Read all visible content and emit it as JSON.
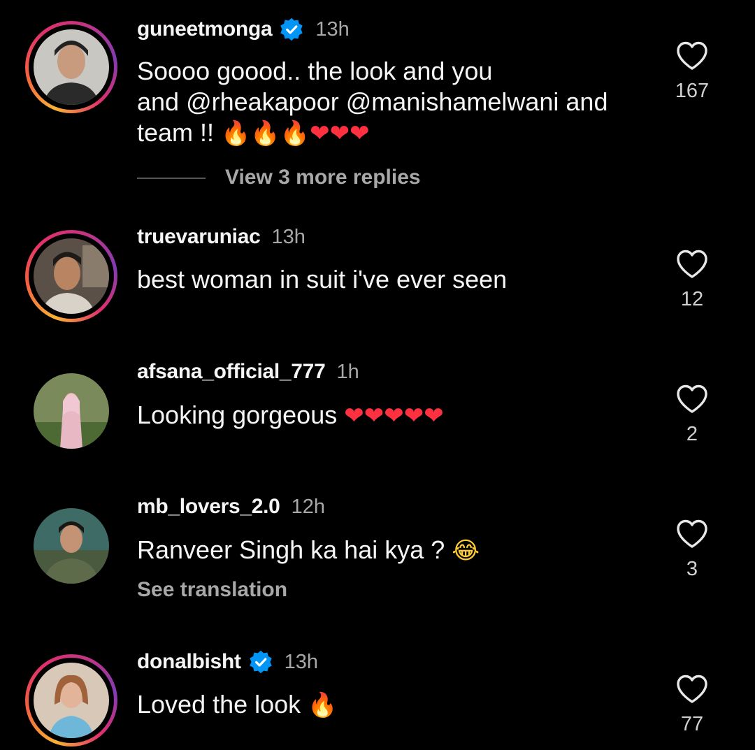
{
  "comments": [
    {
      "username": "guneetmonga",
      "verified": true,
      "time": "13h",
      "text_lines": [
        "Soooo goood.. the look and you",
        "and @rheakapoor @manishamelwani and",
        "team !! "
      ],
      "emoji": [
        "🔥",
        "🔥",
        "🔥",
        "❤",
        "❤",
        "❤"
      ],
      "likes": "167",
      "replies_label": "View 3 more replies",
      "story_ring": true
    },
    {
      "username": "truevaruniac",
      "verified": false,
      "time": "13h",
      "text": "best woman in suit i've ever seen",
      "likes": "12",
      "story_ring": true
    },
    {
      "username": "afsana_official_777",
      "verified": false,
      "time": "1h",
      "text": "Looking gorgeous ",
      "emoji": [
        "❤",
        "❤",
        "❤",
        "❤",
        "❤"
      ],
      "likes": "2",
      "story_ring": false
    },
    {
      "username": "mb_lovers_2.0",
      "verified": false,
      "time": "12h",
      "text": "Ranveer Singh ka hai kya ? ",
      "emoji": [
        "😂"
      ],
      "likes": "3",
      "translation_label": "See translation",
      "story_ring": false
    },
    {
      "username": "donalbisht",
      "verified": true,
      "time": "13h",
      "text": "Loved the look ",
      "emoji": [
        "🔥"
      ],
      "likes": "77",
      "story_ring": true
    }
  ],
  "icons": {
    "like": "heart-outline-icon",
    "verified": "verified-badge-icon"
  },
  "colors": {
    "background": "#000000",
    "text": "#f5f5f5",
    "secondary": "#a8a8a8",
    "verified": "#0095f6",
    "heart_emoji": "#ff3040"
  }
}
